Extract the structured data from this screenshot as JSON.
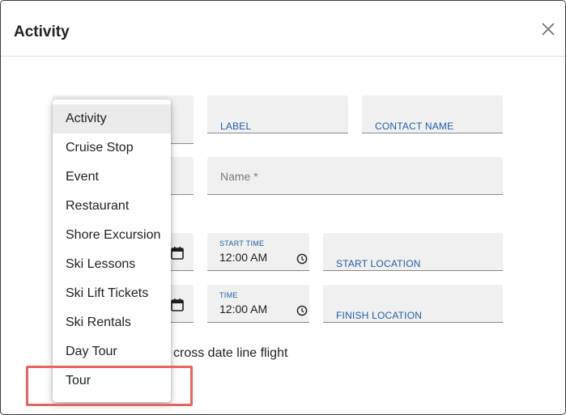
{
  "dialog": {
    "title": "Activity"
  },
  "fields": {
    "label": "LABEL",
    "contact_name": "CONTACT NAME",
    "name_placeholder": "Name *",
    "start_time_label": "START TIME",
    "start_time_value": "12:00 AM",
    "start_location": "START LOCATION",
    "end_time_label": "TIME",
    "end_time_value": "12:00 AM",
    "finish_location": "FINISH LOCATION"
  },
  "checkbox": {
    "text_visible": "cross date line flight"
  },
  "menu": {
    "items": [
      {
        "label": "Activity",
        "selected": true
      },
      {
        "label": "Cruise Stop"
      },
      {
        "label": "Event"
      },
      {
        "label": "Restaurant"
      },
      {
        "label": "Shore Excursion"
      },
      {
        "label": "Ski Lessons"
      },
      {
        "label": "Ski Lift Tickets"
      },
      {
        "label": "Ski Rentals"
      },
      {
        "label": "Day Tour"
      },
      {
        "label": "Tour",
        "highlighted": true
      }
    ]
  },
  "colors": {
    "accent": "#1f5ea8",
    "highlight_border": "#e8655c",
    "field_bg": "#f0f0f0"
  },
  "icons": {
    "close": "close-icon",
    "calendar": "calendar-icon",
    "clock": "clock-icon"
  }
}
